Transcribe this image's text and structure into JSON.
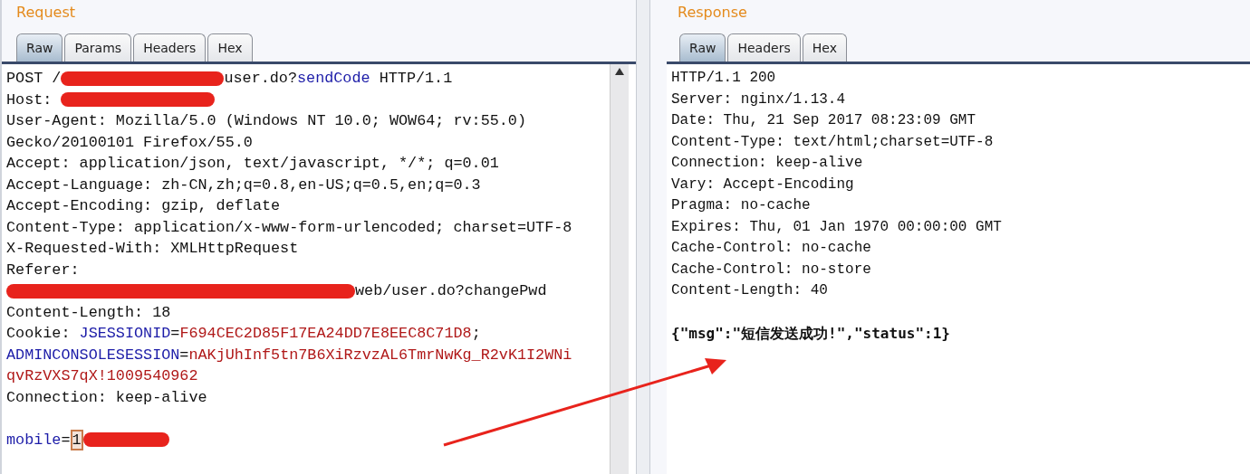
{
  "request": {
    "title": "Request",
    "tabs": [
      {
        "label": "Raw",
        "selected": true
      },
      {
        "label": "Params",
        "selected": false
      },
      {
        "label": "Headers",
        "selected": false
      },
      {
        "label": "Hex",
        "selected": false
      }
    ],
    "lines": [
      {
        "segments": [
          {
            "kind": "plain",
            "text": "POST /"
          },
          {
            "kind": "redacted"
          },
          {
            "kind": "plain",
            "text": "user.do?"
          },
          {
            "kind": "param",
            "text": "sendCode"
          },
          {
            "kind": "plain",
            "text": " HTTP/1.1"
          }
        ]
      },
      {
        "segments": [
          {
            "kind": "plain",
            "text": "Host: "
          },
          {
            "kind": "redacted"
          }
        ]
      },
      {
        "segments": [
          {
            "kind": "plain",
            "text": "User-Agent: Mozilla/5.0 (Windows NT 10.0; WOW64; rv:55.0)"
          }
        ]
      },
      {
        "segments": [
          {
            "kind": "plain",
            "text": "Gecko/20100101 Firefox/55.0"
          }
        ]
      },
      {
        "segments": [
          {
            "kind": "plain",
            "text": "Accept: application/json, text/javascript, */*; q=0.01"
          }
        ]
      },
      {
        "segments": [
          {
            "kind": "plain",
            "text": "Accept-Language: zh-CN,zh;q=0.8,en-US;q=0.5,en;q=0.3"
          }
        ]
      },
      {
        "segments": [
          {
            "kind": "plain",
            "text": "Accept-Encoding: gzip, deflate"
          }
        ]
      },
      {
        "segments": [
          {
            "kind": "plain",
            "text": "Content-Type: application/x-www-form-urlencoded; charset=UTF-8"
          }
        ]
      },
      {
        "segments": [
          {
            "kind": "plain",
            "text": "X-Requested-With: XMLHttpRequest"
          }
        ]
      },
      {
        "segments": [
          {
            "kind": "plain",
            "text": "Referer:"
          }
        ]
      },
      {
        "segments": [
          {
            "kind": "redacted"
          },
          {
            "kind": "plain",
            "text": "web/user.do?changePwd"
          }
        ]
      },
      {
        "segments": [
          {
            "kind": "plain",
            "text": "Content-Length: 18"
          }
        ]
      },
      {
        "segments": [
          {
            "kind": "plain",
            "text": "Cookie: "
          },
          {
            "kind": "param",
            "text": "JSESSIONID"
          },
          {
            "kind": "plain",
            "text": "="
          },
          {
            "kind": "value",
            "text": "F694CEC2D85F17EA24DD7E8EEC8C71D8"
          },
          {
            "kind": "plain",
            "text": ";"
          }
        ]
      },
      {
        "segments": [
          {
            "kind": "param",
            "text": "ADMINCONSOLESESSION"
          },
          {
            "kind": "plain",
            "text": "="
          },
          {
            "kind": "value",
            "text": "nAKjUhInf5tn7B6XiRzvzAL6TmrNwKg_R2vK1I2WNi"
          }
        ]
      },
      {
        "segments": [
          {
            "kind": "value",
            "text": "qvRzVXS7qX!1009540962"
          }
        ]
      },
      {
        "segments": [
          {
            "kind": "plain",
            "text": "Connection: keep-alive"
          }
        ]
      },
      {
        "space_before": true,
        "segments": [
          {
            "kind": "param",
            "text": "mobile"
          },
          {
            "kind": "plain",
            "text": "="
          },
          {
            "kind": "highlight",
            "text": "1"
          },
          {
            "kind": "redacted"
          }
        ]
      }
    ]
  },
  "response": {
    "title": "Response",
    "tabs": [
      {
        "label": "Raw",
        "selected": true
      },
      {
        "label": "Headers",
        "selected": false
      },
      {
        "label": "Hex",
        "selected": false
      }
    ],
    "lines": [
      {
        "segments": [
          {
            "kind": "plain",
            "text": "HTTP/1.1 200"
          }
        ]
      },
      {
        "segments": [
          {
            "kind": "plain",
            "text": "Server: nginx/1.13.4"
          }
        ]
      },
      {
        "segments": [
          {
            "kind": "plain",
            "text": "Date: Thu, 21 Sep 2017 08:23:09 GMT"
          }
        ]
      },
      {
        "segments": [
          {
            "kind": "plain",
            "text": "Content-Type: text/html;charset=UTF-8"
          }
        ]
      },
      {
        "segments": [
          {
            "kind": "plain",
            "text": "Connection: keep-alive"
          }
        ]
      },
      {
        "segments": [
          {
            "kind": "plain",
            "text": "Vary: Accept-Encoding"
          }
        ]
      },
      {
        "segments": [
          {
            "kind": "plain",
            "text": "Pragma: no-cache"
          }
        ]
      },
      {
        "segments": [
          {
            "kind": "plain",
            "text": "Expires: Thu, 01 Jan 1970 00:00:00 GMT"
          }
        ]
      },
      {
        "segments": [
          {
            "kind": "plain",
            "text": "Cache-Control: no-cache"
          }
        ]
      },
      {
        "segments": [
          {
            "kind": "plain",
            "text": "Cache-Control: no-store"
          }
        ]
      },
      {
        "segments": [
          {
            "kind": "plain",
            "text": "Content-Length: 40"
          }
        ]
      },
      {
        "space_before": true,
        "segments": [
          {
            "kind": "bold",
            "text": "{\"msg\":\"短信发送成功!\",\"status\":1}"
          }
        ]
      }
    ]
  }
}
